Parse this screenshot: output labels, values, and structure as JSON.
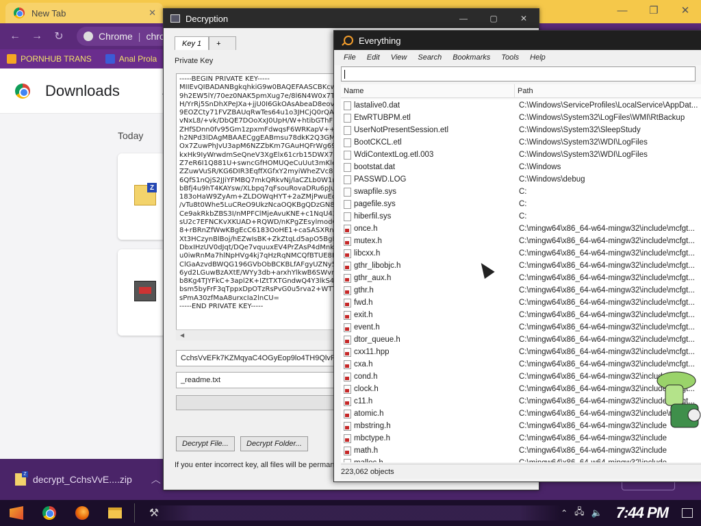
{
  "chrome": {
    "tab_title": "New Tab",
    "omnibox_site": "Chrome",
    "omnibox_url": "chro",
    "bookmarks": [
      "PORNHUB TRANS",
      "Anal Prola"
    ],
    "page_title": "Downloads",
    "section": "Today",
    "shelf_file": "decrypt_CchsVvE....zip"
  },
  "decryption": {
    "title": "Decryption",
    "tabs": [
      "Key 1",
      "+"
    ],
    "private_key_label": "Private Key",
    "private_key_text": "-----BEGIN PRIVATE KEY-----\nMIIEvQIBADANBgkqhkiG9w0BAQEFAASCBKcwg\n9h2EW5lY/70ez0NAK5pmXug7e/8l6N4W0x7Tc\nH/YrRj5SnDhXPeJXa+jjU0I6GkOAsAbeaD8eov\n9EOZCty71FVZBAUqRwTes64u1o3JHCjQ0rQA\nvNxL8/+vk/DbQE7DOoXxJ0UpH/W+htibGThF\nZHfSDnn0fv95Gm1zpxmFdwqsF6WRKapV++3c\nh2NPd3lDAgMBAAECggEABmsu78dkK2Q3GMTA\nOx7ZuwPhJvU3apM6NZZbKm7GAuHQFrWg69x\nkxHk9IyWrwdmSeQneV3XgElx61crb15DWX7Ff\nZ7eR6I1Q881U+swncGfHOMUQeCuUut3mKlen\nZZuwVuSR/KG6DIR3EqffXGfxY2myiWheZVc8LD\n6QfS1nQjS2JJiYFMBQ7mkQRkvNj/laCZLb0W1r\nbBfj4u9hT4KAYsw/XLbpq7qFsouRovaDRu6pJu\n183oHaW9ZyAm+ZLDOWqHYT+2aZMjPwuEqiz\n/vTu8t0Whe5LuCReO9UkzNcaOQKBgQDzGN83\nCe9akRkbZBS3I/nMPFClMjeAvuKNE+c1NqU426\nsU2c7EFNCKvXKUAD+RQWD/nKPgZEsylmodCk\n8+rBRnZfWwKBgEcC6183OoHE1+caSASXRnrW\nXt3HCzynBlBoj/hEZwIsBK+ZkZtqLd5apO5BgMF\nDbxIHzUV0dJqt/DQe7vquuxEV4PrZAsP4dMnky\nu0iwRnMa7hlNpHVg4kj7qHzRqNMCQfBTUE8H/\nClGaAzvdBWQG196GVbObBCKBLfAFgyUZNy5k\n6yd2LGuwBzAXtE/WYy3db+arxhYlkwB6SWvne\nb8Kg4TJYFkC+3apl2K+IZtTXTGndwQ4Y3lkS4Q\nbsm5byFrF3qTppxDpOTzRsPvG0u5rva2+WTTc\nsPmA30zfMaA8urxcIa2lnCU=\n-----END PRIVATE KEY-----",
    "id_field": "CchsVvEFk7KZMqyaC4OGyEop9lo4TH9QlvPqpv",
    "filename_field": "_readme.txt",
    "decrypt_file_btn": "Decrypt File...",
    "decrypt_folder_btn": "Decrypt Folder...",
    "note": "If you enter incorrect key, all files will be perman"
  },
  "everything": {
    "title": "Everything",
    "menu": [
      "File",
      "Edit",
      "View",
      "Search",
      "Bookmarks",
      "Tools",
      "Help"
    ],
    "columns": [
      "Name",
      "Path"
    ],
    "rows": [
      {
        "name": "lastalive0.dat",
        "path": "C:\\Windows\\ServiceProfiles\\LocalService\\AppDat...",
        "h": false
      },
      {
        "name": "EtwRTUBPM.etl",
        "path": "C:\\Windows\\System32\\LogFiles\\WMI\\RtBackup",
        "h": false
      },
      {
        "name": "UserNotPresentSession.etl",
        "path": "C:\\Windows\\System32\\SleepStudy",
        "h": false
      },
      {
        "name": "BootCKCL.etl",
        "path": "C:\\Windows\\System32\\WDI\\LogFiles",
        "h": false
      },
      {
        "name": "WdiContextLog.etl.003",
        "path": "C:\\Windows\\System32\\WDI\\LogFiles",
        "h": false
      },
      {
        "name": "bootstat.dat",
        "path": "C:\\Windows",
        "h": false
      },
      {
        "name": "PASSWD.LOG",
        "path": "C:\\Windows\\debug",
        "h": false
      },
      {
        "name": "swapfile.sys",
        "path": "C:",
        "h": false
      },
      {
        "name": "pagefile.sys",
        "path": "C:",
        "h": false
      },
      {
        "name": "hiberfil.sys",
        "path": "C:",
        "h": false
      },
      {
        "name": "once.h",
        "path": "C:\\mingw64\\x86_64-w64-mingw32\\include\\mcfgt...",
        "h": true
      },
      {
        "name": "mutex.h",
        "path": "C:\\mingw64\\x86_64-w64-mingw32\\include\\mcfgt...",
        "h": true
      },
      {
        "name": "libcxx.h",
        "path": "C:\\mingw64\\x86_64-w64-mingw32\\include\\mcfgt...",
        "h": true
      },
      {
        "name": "gthr_libobjc.h",
        "path": "C:\\mingw64\\x86_64-w64-mingw32\\include\\mcfgt...",
        "h": true
      },
      {
        "name": "gthr_aux.h",
        "path": "C:\\mingw64\\x86_64-w64-mingw32\\include\\mcfgt...",
        "h": true
      },
      {
        "name": "gthr.h",
        "path": "C:\\mingw64\\x86_64-w64-mingw32\\include\\mcfgt...",
        "h": true
      },
      {
        "name": "fwd.h",
        "path": "C:\\mingw64\\x86_64-w64-mingw32\\include\\mcfgt...",
        "h": true
      },
      {
        "name": "exit.h",
        "path": "C:\\mingw64\\x86_64-w64-mingw32\\include\\mcfgt...",
        "h": true
      },
      {
        "name": "event.h",
        "path": "C:\\mingw64\\x86_64-w64-mingw32\\include\\mcfgt...",
        "h": true
      },
      {
        "name": "dtor_queue.h",
        "path": "C:\\mingw64\\x86_64-w64-mingw32\\include\\mcfgt...",
        "h": true
      },
      {
        "name": "cxx11.hpp",
        "path": "C:\\mingw64\\x86_64-w64-mingw32\\include\\mcfgt...",
        "h": true
      },
      {
        "name": "cxa.h",
        "path": "C:\\mingw64\\x86_64-w64-mingw32\\include\\mcfgt...",
        "h": true
      },
      {
        "name": "cond.h",
        "path": "C:\\mingw64\\x86_64-w64-mingw32\\include\\mcfgt...",
        "h": true
      },
      {
        "name": "clock.h",
        "path": "C:\\mingw64\\x86_64-w64-mingw32\\include\\mcfgt...",
        "h": true
      },
      {
        "name": "c11.h",
        "path": "C:\\mingw64\\x86_64-w64-mingw32\\include\\mcfgt...",
        "h": true
      },
      {
        "name": "atomic.h",
        "path": "C:\\mingw64\\x86_64-w64-mingw32\\include\\mcfgt...",
        "h": true
      },
      {
        "name": "mbstring.h",
        "path": "C:\\mingw64\\x86_64-w64-mingw32\\include",
        "h": true
      },
      {
        "name": "mbctype.h",
        "path": "C:\\mingw64\\x86_64-w64-mingw32\\include",
        "h": true
      },
      {
        "name": "math.h",
        "path": "C:\\mingw64\\x86_64-w64-mingw32\\include",
        "h": true
      },
      {
        "name": "malloc.h",
        "path": "C:\\mingw64\\x86_64-w64-mingw32\\include",
        "h": true
      }
    ],
    "status": "223,062 objects"
  },
  "taskbar": {
    "clock": "7:44 PM"
  }
}
